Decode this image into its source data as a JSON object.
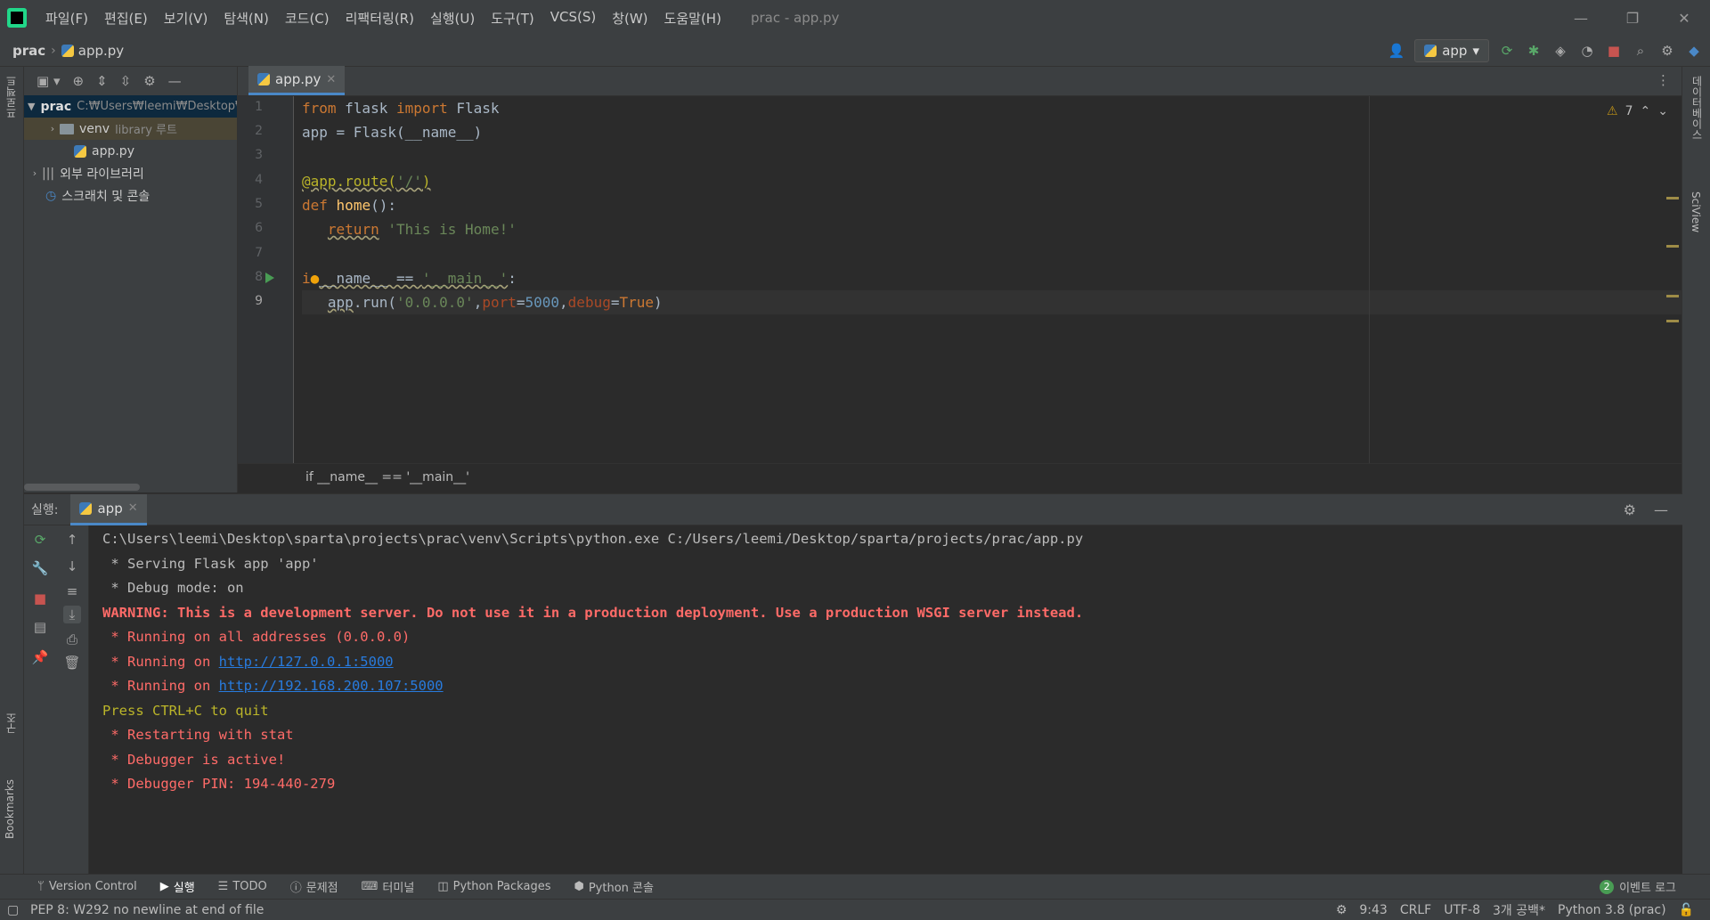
{
  "menu": [
    "파일(F)",
    "편집(E)",
    "보기(V)",
    "탐색(N)",
    "코드(C)",
    "리팩터링(R)",
    "실행(U)",
    "도구(T)",
    "VCS(S)",
    "창(W)",
    "도움말(H)"
  ],
  "window_title": "prac - app.py",
  "window_controls": {
    "minimize": "—",
    "restore": "❐",
    "close": "✕"
  },
  "breadcrumb": {
    "project": "prac",
    "file": "app.py"
  },
  "run_config": "app",
  "left_strip": {
    "project": "프로젝트",
    "structure": "구조",
    "bookmarks": "Bookmarks"
  },
  "right_strip": {
    "database": "데이터베이스",
    "sciview": "SciView"
  },
  "project_tree": [
    {
      "label": "prac",
      "extra": "C:₩Users₩leemi₩Desktop₩sparta₩projects₩prac",
      "type": "folder",
      "expanded": true
    },
    {
      "label": "venv",
      "extra": "library 루트",
      "type": "folder",
      "expanded": false
    },
    {
      "label": "app.py",
      "extra": "",
      "type": "file"
    },
    {
      "label": "외부 라이브러리",
      "extra": "",
      "type": "lib",
      "expanded": false
    },
    {
      "label": "스크래치 및 콘솔",
      "extra": "",
      "type": "scratch"
    }
  ],
  "editor_tab": "app.py",
  "inspection": {
    "warnings": "7"
  },
  "code_lines": [
    "1",
    "2",
    "3",
    "4",
    "5",
    "6",
    "7",
    "8",
    "9"
  ],
  "code_breadcrumb": "if __name__ == '__main__'",
  "run_panel": {
    "label": "실행:",
    "tab": "app",
    "console": [
      {
        "text": "C:\\Users\\leemi\\Desktop\\sparta\\projects\\prac\\venv\\Scripts\\python.exe C:/Users/leemi/Desktop/sparta/projects/prac/app.py",
        "style": "normal"
      },
      {
        "text": " * Serving Flask app 'app'",
        "style": "normal"
      },
      {
        "text": " * Debug mode: on",
        "style": "normal"
      },
      {
        "text": "WARNING: This is a development server. Do not use it in a production deployment. Use a production WSGI server instead.",
        "style": "warnb"
      },
      {
        "text": " * Running on all addresses (0.0.0.0)",
        "style": "err"
      },
      {
        "text": " * Running on ",
        "style": "err",
        "link": "http://127.0.0.1:5000"
      },
      {
        "text": " * Running on ",
        "style": "err",
        "link": "http://192.168.200.107:5000"
      },
      {
        "text": "Press CTRL+C to quit",
        "style": "yel"
      },
      {
        "text": " * Restarting with stat",
        "style": "err"
      },
      {
        "text": " * Debugger is active!",
        "style": "err"
      },
      {
        "text": " * Debugger PIN: 194-440-279",
        "style": "err"
      }
    ]
  },
  "tool_tabs": [
    {
      "label": "Version Control",
      "icon": "branch-icon"
    },
    {
      "label": "실행",
      "icon": "play-icon",
      "active": true
    },
    {
      "label": "TODO",
      "icon": "list-icon"
    },
    {
      "label": "문제점",
      "icon": "info-icon"
    },
    {
      "label": "터미널",
      "icon": "terminal-icon"
    },
    {
      "label": "Python Packages",
      "icon": "layers-icon"
    },
    {
      "label": "Python 콘솔",
      "icon": "python-icon"
    }
  ],
  "event_log": {
    "count": "2",
    "label": "이벤트 로그"
  },
  "status": {
    "message": "PEP 8: W292 no newline at end of file",
    "position": "9:43",
    "line_sep": "CRLF",
    "encoding": "UTF-8",
    "indent": "3개 공백*",
    "interpreter": "Python 3.8 (prac)"
  }
}
